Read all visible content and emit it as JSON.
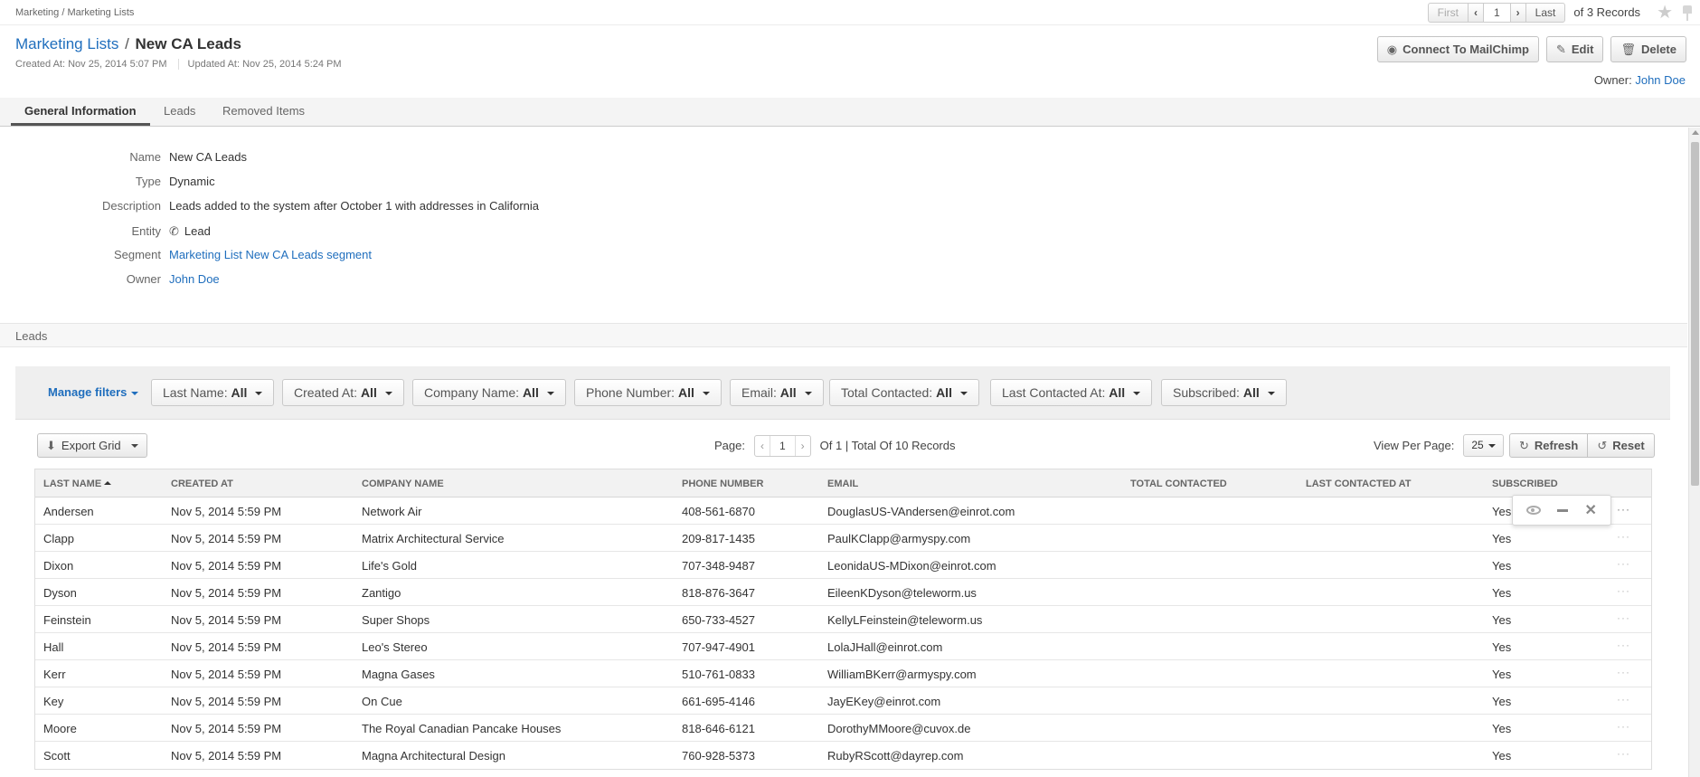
{
  "breadcrumb": "Marketing / Marketing Lists",
  "pager": {
    "first": "First",
    "page": "1",
    "last": "Last",
    "records": "of 3 Records"
  },
  "header": {
    "parent_link": "Marketing Lists",
    "separator": "/",
    "title": "New CA Leads",
    "created": "Created At: Nov 25, 2014 5:07 PM",
    "updated": "Updated At: Nov 25, 2014 5:24 PM",
    "owner_label": "Owner:",
    "owner_name": "John Doe"
  },
  "actions": {
    "mailchimp": "Connect To MailChimp",
    "edit": "Edit",
    "delete": "Delete"
  },
  "tabs": [
    {
      "label": "General Information",
      "active": true
    },
    {
      "label": "Leads",
      "active": false
    },
    {
      "label": "Removed Items",
      "active": false
    }
  ],
  "info": {
    "name_label": "Name",
    "name": "New CA Leads",
    "type_label": "Type",
    "type": "Dynamic",
    "description_label": "Description",
    "description": "Leads added to the system after October 1 with addresses in California",
    "entity_label": "Entity",
    "entity": "Lead",
    "segment_label": "Segment",
    "segment": "Marketing List New CA Leads segment",
    "owner_label": "Owner",
    "owner": "John Doe"
  },
  "leads_section": "Leads",
  "filters": {
    "manage": "Manage filters",
    "items": [
      {
        "label": "Last Name:",
        "value": "All"
      },
      {
        "label": "Created At:",
        "value": "All"
      },
      {
        "label": "Company Name:",
        "value": "All"
      },
      {
        "label": "Phone Number:",
        "value": "All"
      },
      {
        "label": "Email:",
        "value": "All"
      },
      {
        "label": "Total Contacted:",
        "value": "All"
      },
      {
        "label": "Last Contacted At:",
        "value": "All"
      },
      {
        "label": "Subscribed:",
        "value": "All"
      }
    ]
  },
  "grid_toolbar": {
    "export": "Export Grid",
    "page_label": "Page:",
    "page": "1",
    "page_total": "Of 1 | Total Of 10 Records",
    "view_per_page_label": "View Per Page:",
    "view_per_page": "25",
    "refresh": "Refresh",
    "reset": "Reset"
  },
  "grid": {
    "columns": [
      "Last Name",
      "Created At",
      "Company Name",
      "Phone Number",
      "Email",
      "Total Contacted",
      "Last Contacted At",
      "Subscribed"
    ],
    "rows": [
      [
        "Andersen",
        "Nov 5, 2014 5:59 PM",
        "Network Air",
        "408-561-6870",
        "DouglasUS-VAndersen@einrot.com",
        "",
        "",
        "Yes"
      ],
      [
        "Clapp",
        "Nov 5, 2014 5:59 PM",
        "Matrix Architectural Service",
        "209-817-1435",
        "PaulKClapp@armyspy.com",
        "",
        "",
        "Yes"
      ],
      [
        "Dixon",
        "Nov 5, 2014 5:59 PM",
        "Life's Gold",
        "707-348-9487",
        "LeonidaUS-MDixon@einrot.com",
        "",
        "",
        "Yes"
      ],
      [
        "Dyson",
        "Nov 5, 2014 5:59 PM",
        "Zantigo",
        "818-876-3647",
        "EileenKDyson@teleworm.us",
        "",
        "",
        "Yes"
      ],
      [
        "Feinstein",
        "Nov 5, 2014 5:59 PM",
        "Super Shops",
        "650-733-4527",
        "KellyLFeinstein@teleworm.us",
        "",
        "",
        "Yes"
      ],
      [
        "Hall",
        "Nov 5, 2014 5:59 PM",
        "Leo's Stereo",
        "707-947-4901",
        "LolaJHall@einrot.com",
        "",
        "",
        "Yes"
      ],
      [
        "Kerr",
        "Nov 5, 2014 5:59 PM",
        "Magna Gases",
        "510-761-0833",
        "WilliamBKerr@armyspy.com",
        "",
        "",
        "Yes"
      ],
      [
        "Key",
        "Nov 5, 2014 5:59 PM",
        "On Cue",
        "661-695-4146",
        "JayEKey@einrot.com",
        "",
        "",
        "Yes"
      ],
      [
        "Moore",
        "Nov 5, 2014 5:59 PM",
        "The Royal Canadian Pancake Houses",
        "818-646-6121",
        "DorothyMMoore@cuvox.de",
        "",
        "",
        "Yes"
      ],
      [
        "Scott",
        "Nov 5, 2014 5:59 PM",
        "Magna Architectural Design",
        "760-928-5373",
        "RubyRScott@dayrep.com",
        "",
        "",
        "Yes"
      ]
    ]
  },
  "colors": {
    "link": "#1f6ebd",
    "text": "#444444",
    "tab_bg": "#f4f4f4",
    "filter_bg": "#efefef"
  }
}
